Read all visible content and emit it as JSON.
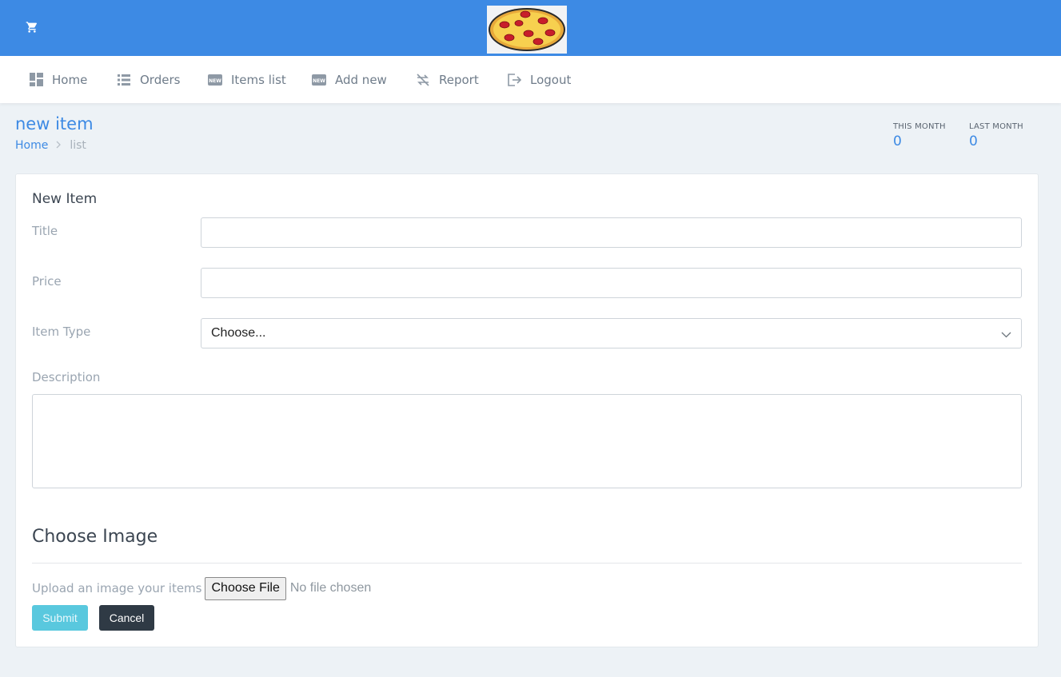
{
  "header": {
    "cart_icon": "shopping-cart-icon",
    "logo": "pizza-logo"
  },
  "nav": {
    "items": [
      {
        "label": "Home",
        "icon": "dashboard-icon"
      },
      {
        "label": "Orders",
        "icon": "list-icon"
      },
      {
        "label": "Items list",
        "icon": "new-badge-icon"
      },
      {
        "label": "Add new",
        "icon": "new-badge-icon"
      },
      {
        "label": "Report",
        "icon": "repeat-icon"
      },
      {
        "label": "Logout",
        "icon": "logout-icon"
      }
    ]
  },
  "page": {
    "title": "new item",
    "breadcrumb": {
      "home": "Home",
      "separator": ">",
      "current": "list"
    }
  },
  "stats": [
    {
      "label": "THIS MONTH",
      "value": "0"
    },
    {
      "label": "LAST MONTH",
      "value": "0"
    }
  ],
  "form": {
    "title": "New Item",
    "title_label": "Title",
    "title_value": "",
    "price_label": "Price",
    "price_value": "",
    "type_label": "Item Type",
    "type_selected": "Choose...",
    "description_label": "Description",
    "description_value": "",
    "image_section_title": "Choose Image",
    "upload_label": "Upload an image your items",
    "file_button": "Choose File",
    "file_status": "No file chosen",
    "submit_label": "Submit",
    "cancel_label": "Cancel"
  },
  "colors": {
    "primary": "#3d8ae4",
    "submit": "#59c8de",
    "cancel": "#2f3a45",
    "background": "#edf2f6"
  }
}
